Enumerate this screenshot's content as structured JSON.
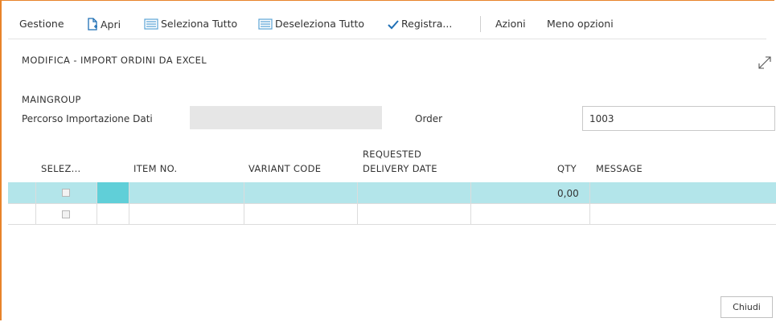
{
  "toolbar": {
    "gestione": "Gestione",
    "apri": "Apri",
    "seleziona_tutto": "Seleziona Tutto",
    "deseleziona_tutto": "Deseleziona Tutto",
    "registra": "Registra...",
    "azioni": "Azioni",
    "meno_opzioni": "Meno opzioni"
  },
  "page": {
    "title": "MODIFICA - IMPORT ORDINI DA EXCEL"
  },
  "maingroup": {
    "title": "MAINGROUP",
    "path_label": "Percorso Importazione Dati",
    "path_value": "",
    "order_label": "Order",
    "order_value": "1003"
  },
  "table": {
    "columns": [
      "SELEZ...",
      "ITEM NO.",
      "VARIANT CODE",
      "REQUESTED",
      "DELIVERY DATE",
      "QTY",
      "MESSAGE"
    ],
    "rows": [
      {
        "selected": false,
        "item_no": "",
        "variant_code": "",
        "requested_delivery_date": "",
        "qty": "0,00",
        "message": ""
      },
      {
        "selected": false,
        "item_no": "",
        "variant_code": "",
        "requested_delivery_date": "",
        "qty": "",
        "message": ""
      }
    ]
  },
  "footer": {
    "close_label": "Chiudi"
  },
  "colors": {
    "accent": "#e8832a",
    "selected_row": "#b3e5ea",
    "active_cell": "#60cfd8",
    "checkmark": "#1f6fb5"
  }
}
